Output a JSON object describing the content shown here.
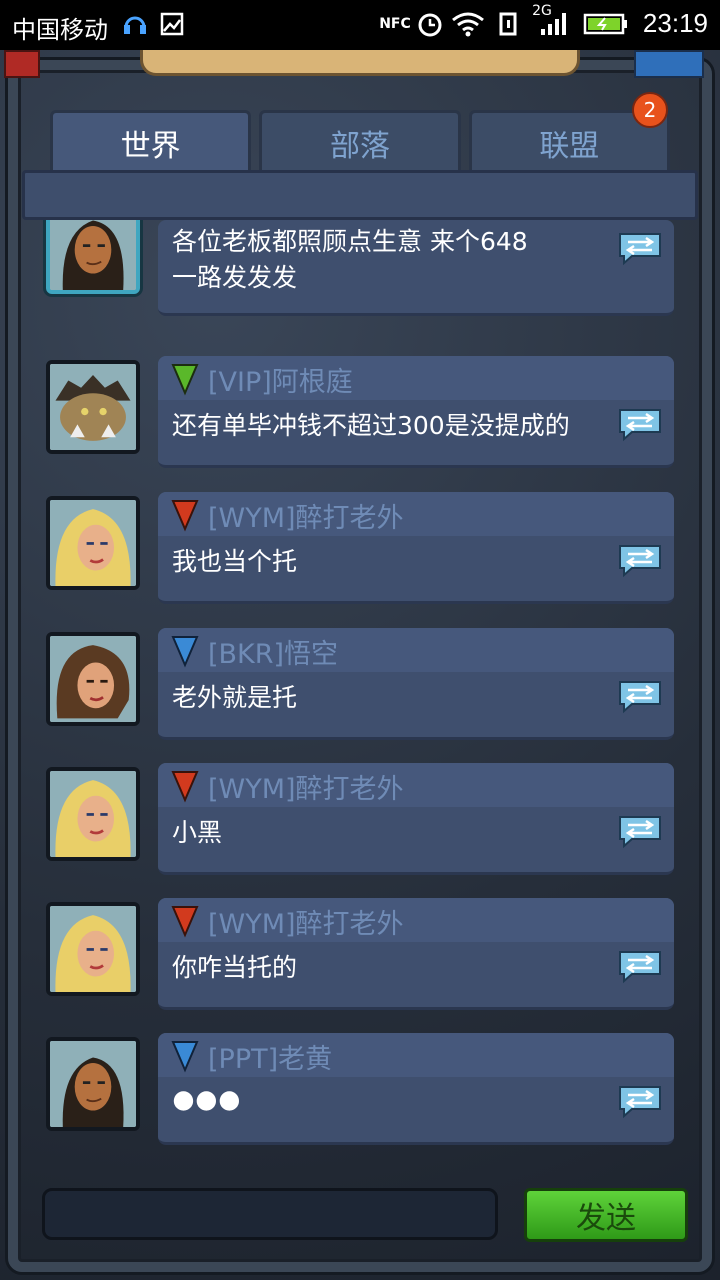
{
  "status_bar": {
    "carrier": "中国移动",
    "network_badge": "2G",
    "nfc_label": "NFC",
    "time": "23:19",
    "icons": [
      "headset-icon",
      "image-icon",
      "nfc-icon",
      "alarm-icon",
      "wifi-icon",
      "vibrate-icon",
      "signal-icon",
      "battery-icon"
    ]
  },
  "tabs": [
    {
      "label": "世界",
      "active": true
    },
    {
      "label": "部落",
      "active": false
    },
    {
      "label": "联盟",
      "active": false
    }
  ],
  "unread_badge": "2",
  "messages": [
    {
      "name": "",
      "flag_color": "",
      "text_lines": [
        "各位老板都照顾点生意 来个648",
        "一路发发发"
      ],
      "avatar": "dark-hair-hero",
      "framed": true
    },
    {
      "name": "[VIP]阿根庭",
      "flag_color": "#5ab82a",
      "text_lines": [
        "还有单毕冲钱不超过300是没提成的"
      ],
      "avatar": "armored-beast"
    },
    {
      "name": "[WYM]醉打老外",
      "flag_color": "#d23a1e",
      "text_lines": [
        "我也当个托"
      ],
      "avatar": "blonde-woman"
    },
    {
      "name": "[BKR]悟空",
      "flag_color": "#3a8ad6",
      "text_lines": [
        "老外就是托"
      ],
      "avatar": "brunette-woman"
    },
    {
      "name": "[WYM]醉打老外",
      "flag_color": "#d23a1e",
      "text_lines": [
        "小黑"
      ],
      "avatar": "blonde-woman"
    },
    {
      "name": "[WYM]醉打老外",
      "flag_color": "#d23a1e",
      "text_lines": [
        "你咋当托的"
      ],
      "avatar": "blonde-woman"
    },
    {
      "name": "[PPT]老黄",
      "flag_color": "#3a8ad6",
      "text_lines": [
        "🌑🌑🌑"
      ],
      "avatar": "dark-hair-hero"
    }
  ],
  "send_button": {
    "label": "发送"
  },
  "message_input": {
    "value": ""
  },
  "colors": {
    "accent_green": "#4cbf2a",
    "bubble": "#3f4f6e",
    "name_text": "#6f8bb6"
  }
}
